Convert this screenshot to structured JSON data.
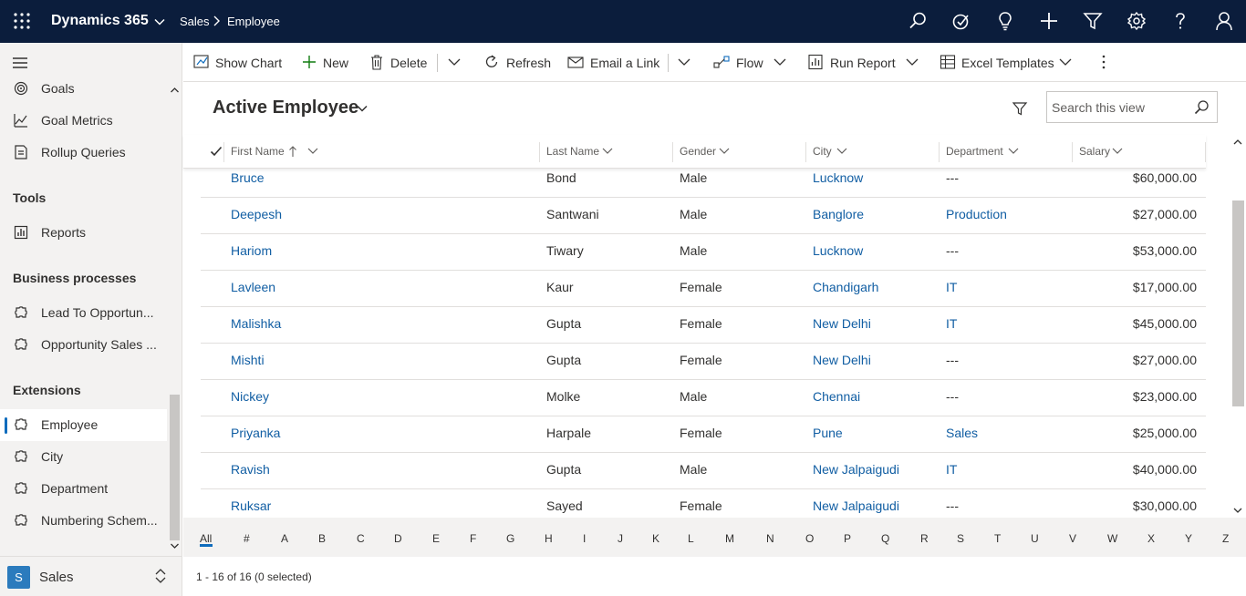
{
  "topbar": {
    "app_title": "Dynamics 365",
    "area": "Sales",
    "entity": "Employee",
    "icons": [
      "search-icon",
      "assistant-icon",
      "lightbulb-icon",
      "plus-icon",
      "filter-icon",
      "settings-icon",
      "help-icon",
      "user-icon"
    ]
  },
  "sidebar": {
    "items_top": [
      {
        "label": "Goals",
        "icon": "goals-icon"
      },
      {
        "label": "Goal Metrics",
        "icon": "goal-metrics-icon"
      },
      {
        "label": "Rollup Queries",
        "icon": "rollup-queries-icon"
      }
    ],
    "tools_header": "Tools",
    "tools_items": [
      {
        "label": "Reports",
        "icon": "reports-icon"
      }
    ],
    "bp_header": "Business processes",
    "bp_items": [
      {
        "label": "Lead To Opportun...",
        "icon": "process-icon"
      },
      {
        "label": "Opportunity Sales ...",
        "icon": "process-icon"
      }
    ],
    "ext_header": "Extensions",
    "ext_items": [
      {
        "label": "Employee",
        "icon": "puzzle-icon",
        "active": true
      },
      {
        "label": "City",
        "icon": "puzzle-icon"
      },
      {
        "label": "Department",
        "icon": "puzzle-icon"
      },
      {
        "label": "Numbering Schem...",
        "icon": "puzzle-icon"
      }
    ],
    "area_badge": "S",
    "area_name": "Sales"
  },
  "commandbar": {
    "show_chart": "Show Chart",
    "new": "New",
    "delete": "Delete",
    "refresh": "Refresh",
    "email_link": "Email a Link",
    "flow": "Flow",
    "run_report": "Run Report",
    "excel_templates": "Excel Templates"
  },
  "view": {
    "title": "Active Employee",
    "search_placeholder": "Search this view"
  },
  "grid": {
    "columns": [
      "First Name",
      "Last Name",
      "Gender",
      "City",
      "Department",
      "Salary"
    ],
    "rows": [
      {
        "first": "Bruce",
        "last": "Bond",
        "gender": "Male",
        "city": "Lucknow",
        "dept": "---",
        "salary": "$60,000.00"
      },
      {
        "first": "Deepesh",
        "last": "Santwani",
        "gender": "Male",
        "city": "Banglore",
        "dept": "Production",
        "salary": "$27,000.00"
      },
      {
        "first": "Hariom",
        "last": "Tiwary",
        "gender": "Male",
        "city": "Lucknow",
        "dept": "---",
        "salary": "$53,000.00"
      },
      {
        "first": "Lavleen",
        "last": "Kaur",
        "gender": "Female",
        "city": "Chandigarh",
        "dept": "IT",
        "salary": "$17,000.00"
      },
      {
        "first": "Malishka",
        "last": "Gupta",
        "gender": "Female",
        "city": "New Delhi",
        "dept": "IT",
        "salary": "$45,000.00"
      },
      {
        "first": "Mishti",
        "last": "Gupta",
        "gender": "Female",
        "city": "New Delhi",
        "dept": "---",
        "salary": "$27,000.00"
      },
      {
        "first": "Nickey",
        "last": "Molke",
        "gender": "Male",
        "city": "Chennai",
        "dept": "---",
        "salary": "$23,000.00"
      },
      {
        "first": "Priyanka",
        "last": "Harpale",
        "gender": "Female",
        "city": "Pune",
        "dept": "Sales",
        "salary": "$25,000.00"
      },
      {
        "first": "Ravish",
        "last": "Gupta",
        "gender": "Male",
        "city": "New Jalpaigudi",
        "dept": "IT",
        "salary": "$40,000.00"
      },
      {
        "first": "Ruksar",
        "last": "Sayed",
        "gender": "Female",
        "city": "New Jalpaigudi",
        "dept": "---",
        "salary": "$30,000.00"
      }
    ]
  },
  "jumpbar": [
    "All",
    "#",
    "A",
    "B",
    "C",
    "D",
    "E",
    "F",
    "G",
    "H",
    "I",
    "J",
    "K",
    "L",
    "M",
    "N",
    "O",
    "P",
    "Q",
    "R",
    "S",
    "T",
    "U",
    "V",
    "W",
    "X",
    "Y",
    "Z"
  ],
  "footer": {
    "status": "1 - 16 of 16 (0 selected)"
  }
}
